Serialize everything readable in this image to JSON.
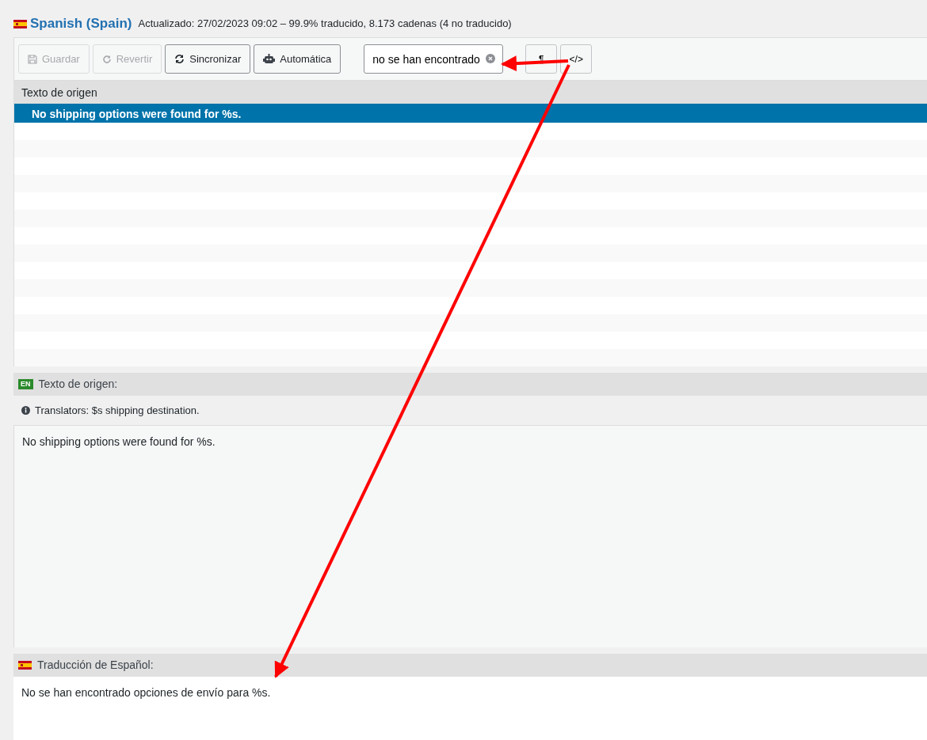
{
  "header": {
    "language": "Spanish (Spain)",
    "meta": "Actualizado: 27/02/2023 09:02 – 99.9% traducido, 8.173 cadenas (4 no traducido)"
  },
  "toolbar": {
    "buttons": [
      {
        "label": "Guardar",
        "kind": "save",
        "disabled": true
      },
      {
        "label": "Revertir",
        "kind": "revert",
        "disabled": true
      },
      {
        "label": "Sincronizar",
        "kind": "sync",
        "disabled": false
      },
      {
        "label": "Automática",
        "kind": "robot",
        "disabled": false
      }
    ],
    "search": {
      "value": "no se han encontrado"
    },
    "toggles": [
      {
        "label": "¶"
      },
      {
        "label": "</>"
      }
    ]
  },
  "list": {
    "header": "Texto de origen",
    "rows": [
      {
        "text": "No shipping options were found for %s.",
        "selected": true
      }
    ]
  },
  "source": {
    "badge": "EN",
    "label": "Texto de origen:",
    "comment": "Translators: $s shipping destination.",
    "text": "No shipping options were found for %s."
  },
  "translation": {
    "label": "Traducción de Español:",
    "text": "No se han encontrado opciones de envío para %s."
  }
}
